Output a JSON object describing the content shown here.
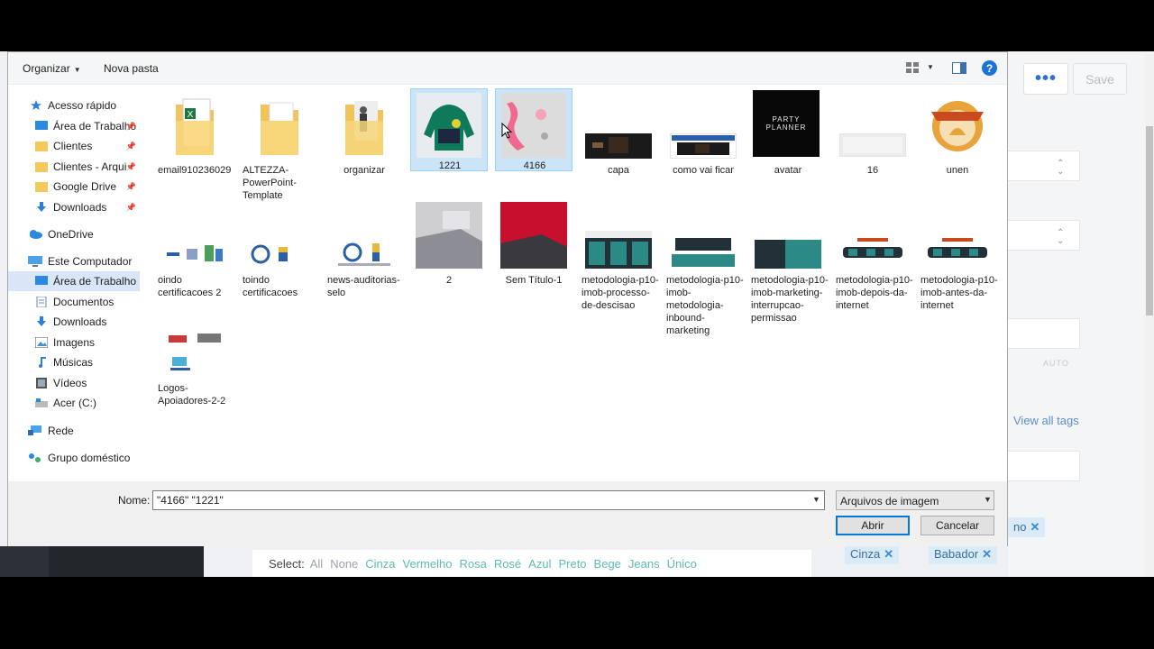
{
  "background": {
    "toolbar_dots": "•••",
    "save_label": "Save",
    "auto_label": "AUTO",
    "view_all_tags": "View all tags",
    "partial_tag": "no",
    "tags": [
      "Cinza",
      "Babador"
    ],
    "select_label": "Select:",
    "select_options": [
      "All",
      "None",
      "Cinza",
      "Vermelho",
      "Rosa",
      "Rosé",
      "Azul",
      "Preto",
      "Bege",
      "Jeans",
      "Único"
    ]
  },
  "toolbar": {
    "organize_label": "Organizar",
    "new_folder_label": "Nova pasta",
    "help_label": "?"
  },
  "sidebar": {
    "quick_access": "Acesso rápido",
    "quick_items": [
      "Área de Trabalho",
      "Clientes",
      "Clientes - Arquivos",
      "Google Drive",
      "Downloads"
    ],
    "onedrive": "OneDrive",
    "this_pc": "Este Computador",
    "pc_items": [
      "Área de Trabalho",
      "Documentos",
      "Downloads",
      "Imagens",
      "Músicas",
      "Vídeos",
      "Acer (C:)"
    ],
    "network": "Rede",
    "homegroup": "Grupo doméstico"
  },
  "files": [
    {
      "name": "email910236029"
    },
    {
      "name": "ALTEZZA-PowerPoint-Template"
    },
    {
      "name": "organizar"
    },
    {
      "name": "1221"
    },
    {
      "name": "4166"
    },
    {
      "name": "capa"
    },
    {
      "name": "como vai ficar"
    },
    {
      "name": "avatar",
      "thumb_text": "PARTY PLANNER"
    },
    {
      "name": "16"
    },
    {
      "name": "unen"
    },
    {
      "name": "oindo certificacoes 2"
    },
    {
      "name": "toindo certificacoes"
    },
    {
      "name": "news-auditorias-selo"
    },
    {
      "name": "2"
    },
    {
      "name": "Sem Título-1"
    },
    {
      "name": "metodologia-p10-imob-processo-de-descisao"
    },
    {
      "name": "metodologia-p10-imob-metodologia-inbound-marketing"
    },
    {
      "name": "metodologia-p10-imob-marketing-interrupcao-permissao"
    },
    {
      "name": "metodologia-p10-imob-depois-da-internet"
    },
    {
      "name": "metodologia-p10-imob-antes-da-internet"
    },
    {
      "name": "Logos-Apoiadores-2-2"
    }
  ],
  "bottom": {
    "name_label": "Nome:",
    "name_value": "\"4166\" \"1221\"",
    "file_type": "Arquivos de imagem",
    "open_label": "Abrir",
    "cancel_label": "Cancelar"
  }
}
